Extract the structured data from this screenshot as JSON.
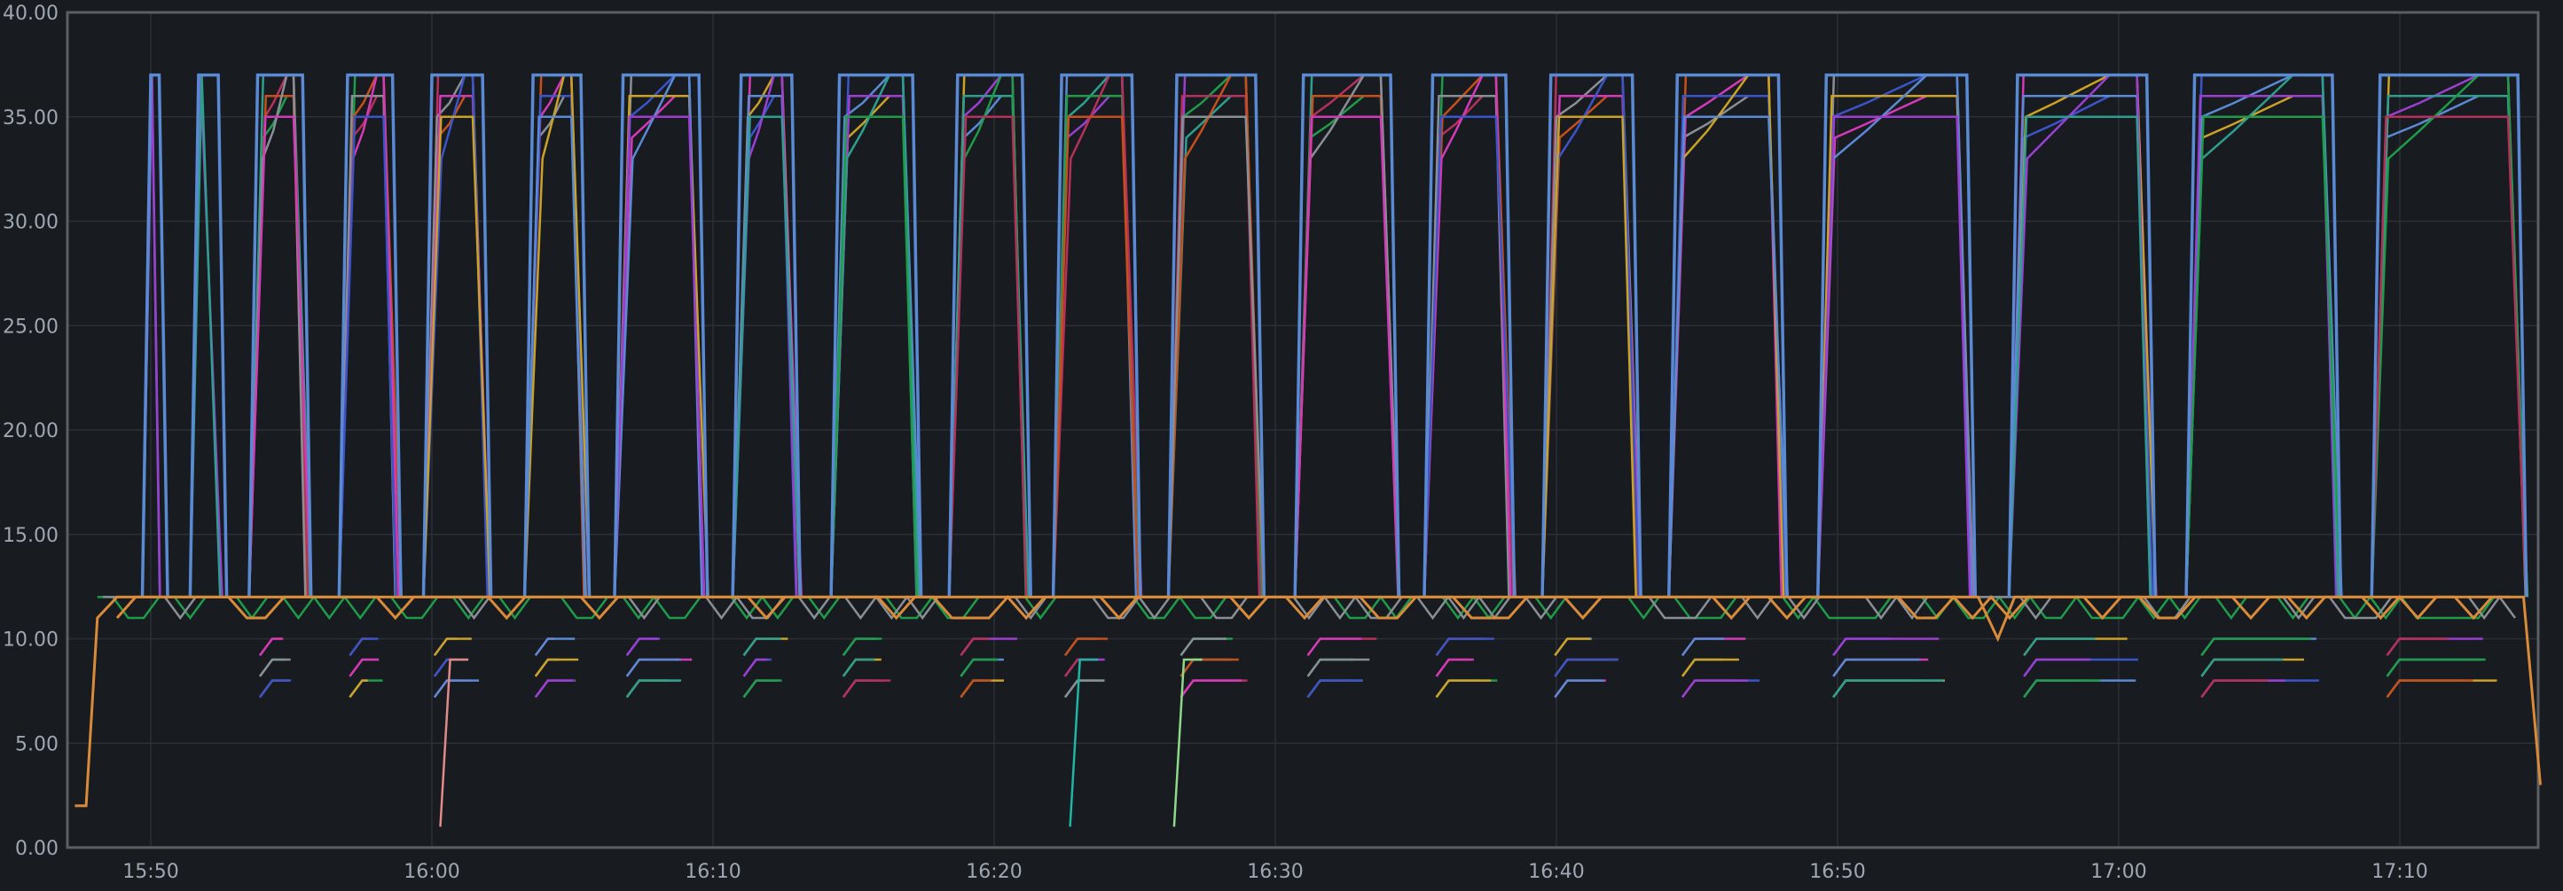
{
  "chart_data": {
    "type": "line",
    "title": "",
    "xlabel": "",
    "ylabel": "",
    "ylim": [
      0,
      40
    ],
    "xlim": [
      "15:47",
      "16:15"
    ],
    "y_ticks": [
      0,
      5,
      10,
      15,
      20,
      25,
      30,
      35,
      40
    ],
    "y_tick_labels": [
      "0.00",
      "5.00",
      "10.00",
      "15.00",
      "20.00",
      "25.00",
      "30.00",
      "35.00",
      "40.00"
    ],
    "x_ticks": [
      "15:50",
      "16:00",
      "16:10",
      "16:20",
      "16:30",
      "16:40",
      "16:50",
      "17:00",
      "17:10"
    ],
    "grid": true,
    "legend": "none",
    "colors": {
      "background": "#181b1f",
      "grid": "#2c3036",
      "frame": "#5a5f66",
      "tick_text": "#9fa7b3"
    },
    "baseline": {
      "color": "#d98b3a",
      "x": [
        "15:47.3",
        "15:47.7",
        "15:48.1",
        "15:48.8",
        "16:55.0",
        "16:55.7",
        "16:56.3",
        "16:57.0",
        "17:14.4",
        "17:15.0"
      ],
      "y": [
        2,
        2,
        11,
        12,
        12,
        10,
        12,
        12,
        12,
        3
      ]
    },
    "busy_periods": [
      {
        "start": "15:50.0",
        "end": "15:50.3",
        "peak": 37
      },
      {
        "start": "15:51.7",
        "end": "15:52.4",
        "peak": 37
      },
      {
        "start": "15:53.8",
        "end": "15:55.4",
        "peak": 37
      },
      {
        "start": "15:57.0",
        "end": "15:58.6",
        "peak": 37
      },
      {
        "start": "16:00.0",
        "end": "16:01.8",
        "peak": 37
      },
      {
        "start": "16:03.6",
        "end": "16:05.3",
        "peak": 37
      },
      {
        "start": "16:06.8",
        "end": "16:09.5",
        "peak": 37
      },
      {
        "start": "16:11.0",
        "end": "16:12.8",
        "peak": 37
      },
      {
        "start": "16:14.5",
        "end": "16:17.1",
        "peak": 37
      },
      {
        "start": "16:18.7",
        "end": "16:21.0",
        "peak": 37
      },
      {
        "start": "16:22.4",
        "end": "16:24.9",
        "peak": 37
      },
      {
        "start": "16:26.5",
        "end": "16:29.3",
        "peak": 37
      },
      {
        "start": "16:31.0",
        "end": "16:34.1",
        "peak": 37
      },
      {
        "start": "16:35.6",
        "end": "16:38.2",
        "peak": 37
      },
      {
        "start": "16:39.8",
        "end": "16:42.7",
        "peak": 37
      },
      {
        "start": "16:44.3",
        "end": "16:47.9",
        "peak": 37
      },
      {
        "start": "16:49.6",
        "end": "16:54.6",
        "peak": 37
      },
      {
        "start": "16:56.4",
        "end": "17:01.0",
        "peak": 37
      },
      {
        "start": "17:02.7",
        "end": "17:07.6",
        "peak": 37
      },
      {
        "start": "17:09.3",
        "end": "17:14.2",
        "peak": 37
      }
    ],
    "series_colors": [
      "#5b8ad4",
      "#9b3fd1",
      "#2e9e8f",
      "#1f9b4a",
      "#b5315c",
      "#c74f1b",
      "#8a8f96",
      "#d23ab8",
      "#3a55c9",
      "#c9a227"
    ]
  }
}
